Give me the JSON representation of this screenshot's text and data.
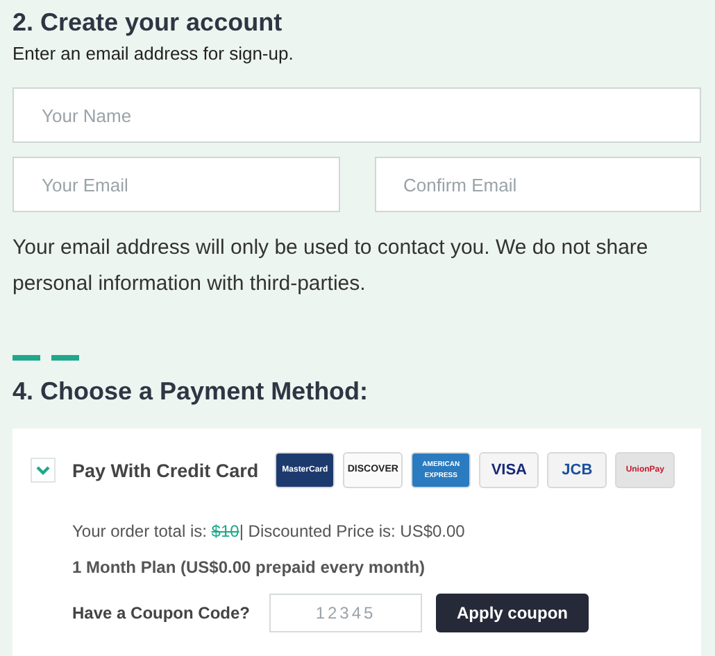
{
  "account": {
    "title": "2. Create your account",
    "subtitle": "Enter an email address for sign-up.",
    "fields": [
      {
        "placeholder": "Your Name"
      },
      {
        "placeholder": "Your Email"
      },
      {
        "placeholder": "Confirm Email"
      }
    ],
    "note": "Your email address will only be used to contact you. We do not share personal information with third-parties."
  },
  "payment": {
    "title": "4. Choose a Payment Method:",
    "method": {
      "label": "Pay With Credit Card",
      "expanded": true,
      "cards": [
        {
          "kind": "mastercard",
          "label": "MasterCard"
        },
        {
          "kind": "discover",
          "label": "DISCOVER"
        },
        {
          "kind": "amex",
          "label": "AMERICAN EXPRESS"
        },
        {
          "kind": "visa",
          "label": "VISA"
        },
        {
          "kind": "jcb",
          "label": "JCB"
        },
        {
          "kind": "unionpay",
          "label": "UnionPay"
        }
      ],
      "order_label": "Your order total is:",
      "old_price": "$10",
      "discount": "| Discounted Price is: US$0.00",
      "plan": "1 Month Plan (US$0.00 prepaid every month)",
      "coupon_label": "Have a Coupon Code?",
      "coupon_placeholder": "12345",
      "apply_button": "Apply coupon"
    }
  }
}
